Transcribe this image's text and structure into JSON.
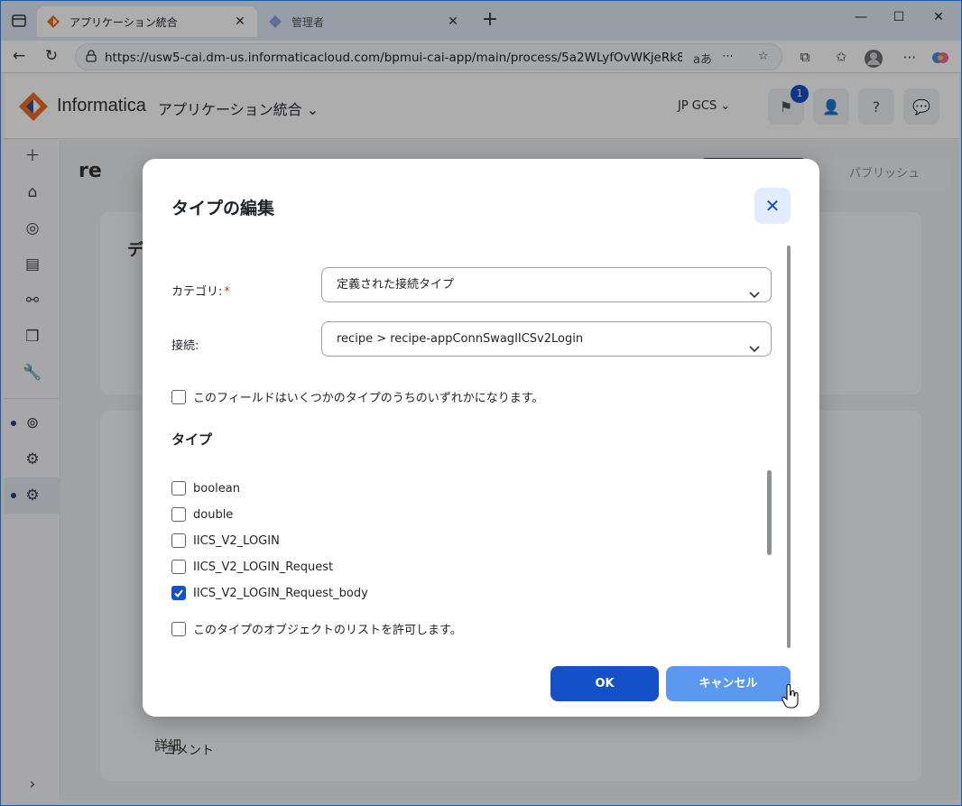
{
  "browser": {
    "tabs": [
      {
        "title": "アプリケーション統合",
        "active": true
      },
      {
        "title": "管理者",
        "active": false
      }
    ],
    "url": "https://usw5-cai.dm-us.informaticacloud.com/bpmui-cai-app/main/process/5a2WLyfOvWKjeRk8Z3A0I5...",
    "reader_label": "aあ"
  },
  "app": {
    "brand": "Informatica",
    "title": "アプリケーション統合",
    "org": "JP GCS",
    "notification_count": "1"
  },
  "background": {
    "breadcrumb_text": "re",
    "publish_label": "パブリッシュ",
    "section_partial": "デ",
    "lower_label1": "詳細",
    "lower_label2": "コメント"
  },
  "dialog": {
    "title": "タイプの編集",
    "category_label": "カテゴリ:",
    "category_required": "*",
    "category_value": "定義された接続タイプ",
    "connection_label": "接続:",
    "connection_value": "recipe > recipe-appConnSwagIICSv2Login",
    "multi_type_label": "このフィールドはいくつかのタイプのうちのいずれかになります。",
    "multi_type_checked": false,
    "types_title": "タイプ",
    "types": [
      {
        "label": "boolean",
        "checked": false
      },
      {
        "label": "double",
        "checked": false
      },
      {
        "label": "IICS_V2_LOGIN",
        "checked": false
      },
      {
        "label": "IICS_V2_LOGIN_Request",
        "checked": false
      },
      {
        "label": "IICS_V2_LOGIN_Request_body",
        "checked": true
      }
    ],
    "allow_list_label": "このタイプのオブジェクトのリストを許可します。",
    "allow_list_checked": false,
    "ok_label": "OK",
    "cancel_label": "キャンセル"
  },
  "colors": {
    "primary": "#1450c8",
    "secondary_button": "#5b98ef",
    "required": "#d0331f"
  }
}
